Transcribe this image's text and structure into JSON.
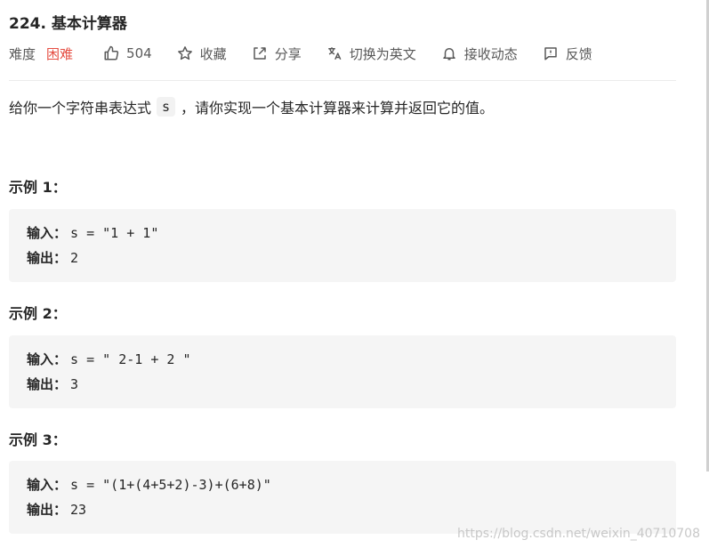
{
  "problem": {
    "title": "224. 基本计算器"
  },
  "meta": {
    "difficulty_label": "难度",
    "difficulty_value": "困难",
    "difficulty_color": "#e54d42",
    "likes_count": "504",
    "favorite_label": "收藏",
    "share_label": "分享",
    "switch_lang_label": "切换为英文",
    "subscribe_label": "接收动态",
    "feedback_label": "反馈"
  },
  "description": {
    "before": "给你一个字符串表达式",
    "code": "s",
    "after": "，请你实现一个基本计算器来计算并返回它的值。"
  },
  "examples": [
    {
      "heading": "示例 1：",
      "input_label": "输入：",
      "input_value": "s = \"1 + 1\"",
      "output_label": "输出：",
      "output_value": "2"
    },
    {
      "heading": "示例 2：",
      "input_label": "输入：",
      "input_value": "s = \" 2-1 + 2 \"",
      "output_label": "输出：",
      "output_value": "3"
    },
    {
      "heading": "示例 3：",
      "input_label": "输入：",
      "input_value": "s = \"(1+(4+5+2)-3)+(6+8)\"",
      "output_label": "输出：",
      "output_value": "23"
    }
  ],
  "watermark": "https://blog.csdn.net/weixin_40710708"
}
